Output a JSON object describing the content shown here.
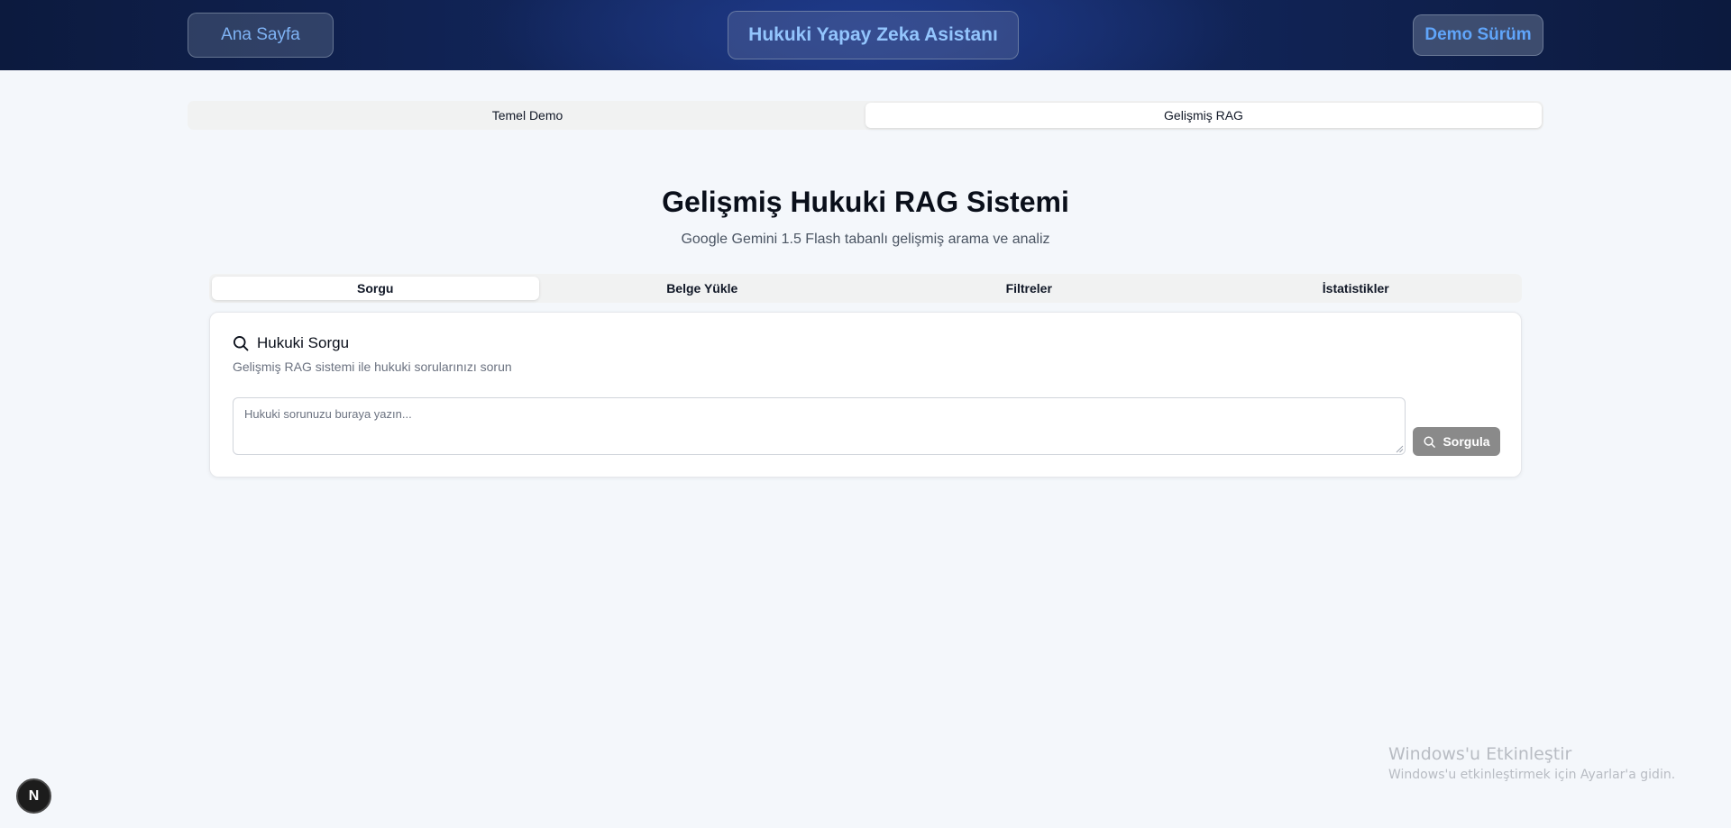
{
  "header": {
    "home_label": "Ana Sayfa",
    "title": "Hukuki Yapay Zeka Asistanı",
    "demo_label": "Demo Sürüm"
  },
  "top_tabs": [
    {
      "label": "Temel Demo",
      "active": false
    },
    {
      "label": "Gelişmiş RAG",
      "active": true
    }
  ],
  "hero": {
    "title": "Gelişmiş Hukuki RAG Sistemi",
    "subtitle": "Google Gemini 1.5 Flash tabanlı gelişmiş arama ve analiz"
  },
  "sub_tabs": [
    {
      "label": "Sorgu",
      "active": true
    },
    {
      "label": "Belge Yükle",
      "active": false
    },
    {
      "label": "Filtreler",
      "active": false
    },
    {
      "label": "İstatistikler",
      "active": false
    }
  ],
  "query_card": {
    "icon": "search-icon",
    "title": "Hukuki Sorgu",
    "description": "Gelişmiş RAG sistemi ile hukuki sorularınızı sorun",
    "input_value": "",
    "input_placeholder": "Hukuki sorunuzu buraya yazın...",
    "submit_label": "Sorgula"
  },
  "watermark": {
    "title": "Windows'u Etkinleştir",
    "subtitle": "Windows'u etkinleştirmek için Ayarlar'a gidin."
  },
  "nextjs_badge": {
    "letter": "N"
  },
  "colors": {
    "header_bg": "#112457",
    "accent_blue": "#60a5fa",
    "page_bg": "#f4f7fb",
    "button_disabled": "#8a8a8a"
  }
}
